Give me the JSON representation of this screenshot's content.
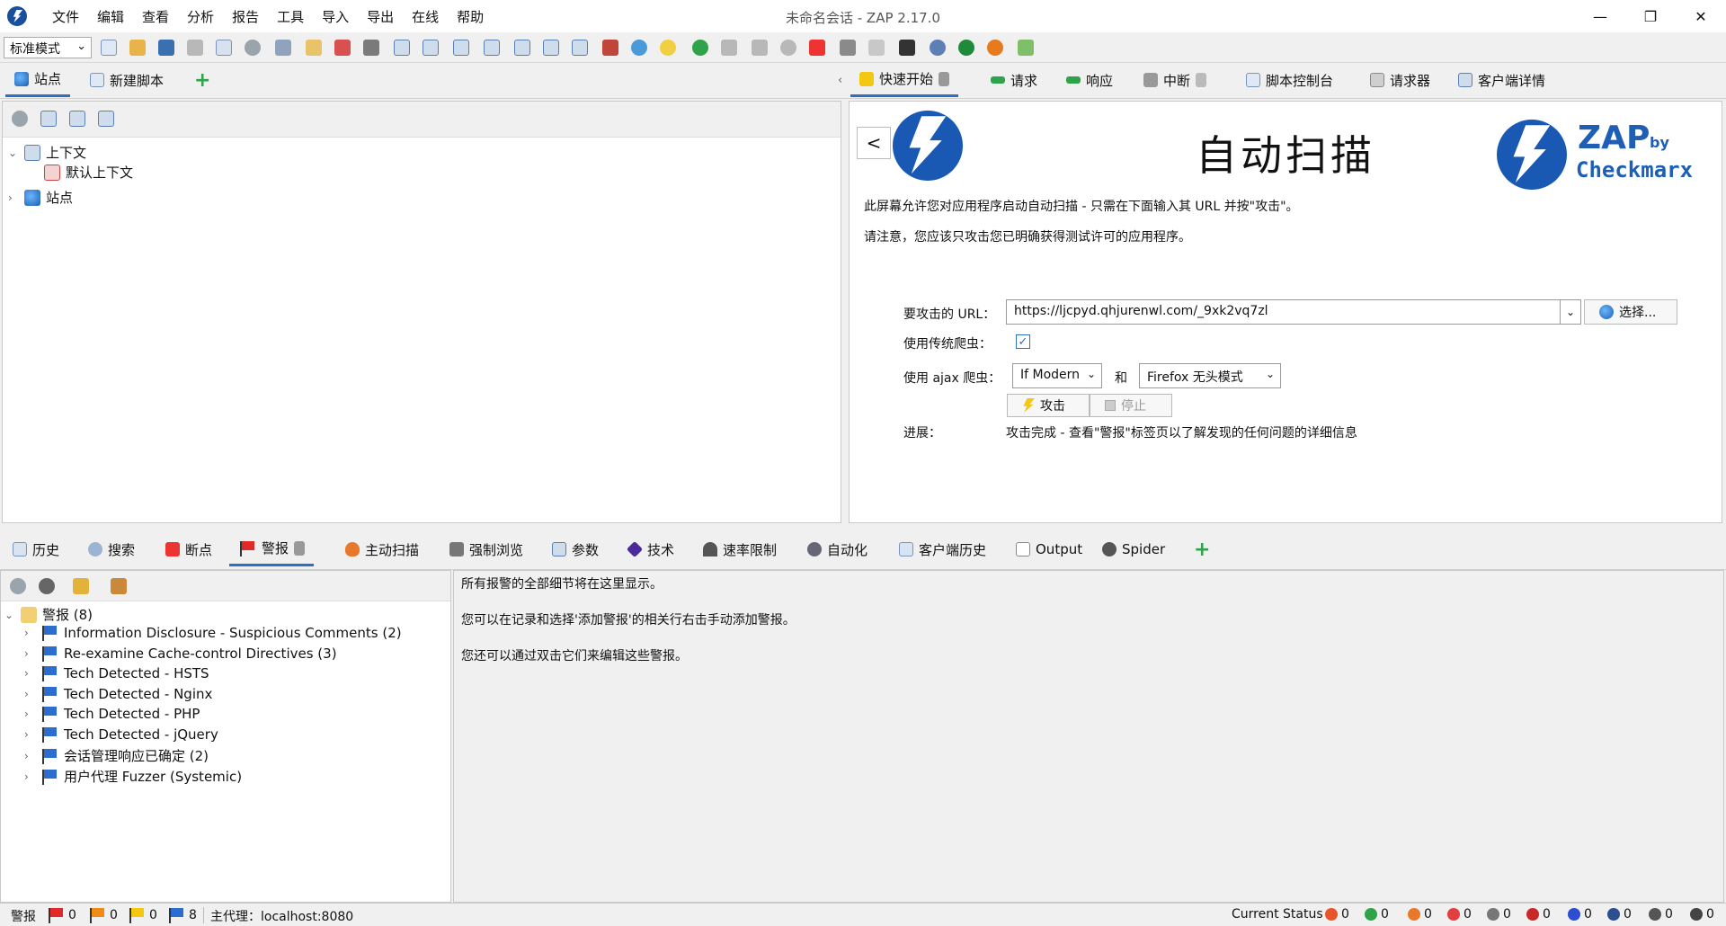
{
  "window": {
    "title": "未命名会话 - ZAP 2.17.0",
    "minimize": "—",
    "maximize": "❐",
    "close": "✕"
  },
  "menu": [
    "文件",
    "编辑",
    "查看",
    "分析",
    "报告",
    "工具",
    "导入",
    "导出",
    "在线",
    "帮助"
  ],
  "toolbar": {
    "mode": "标准模式"
  },
  "sites_tabs": {
    "sites": "站点",
    "new_script": "新建脚本",
    "add": "+"
  },
  "sites_tree": {
    "contexts": "上下文",
    "default_context": "默认上下文",
    "sites": "站点"
  },
  "right_tabs": {
    "quick_start": "快速开始",
    "request": "请求",
    "response": "响应",
    "break": "中断",
    "script_console": "脚本控制台",
    "requester": "请求器",
    "client_details": "客户端详情"
  },
  "quick_start": {
    "back": "<",
    "title": "自动扫描",
    "brand_zap": "ZAP",
    "brand_by": "by",
    "brand_checkmarx": "Checkmarx",
    "intro": "此屏幕允许您对应用程序启动自动扫描 - 只需在下面输入其 URL 并按\"攻击\"。",
    "warning": "请注意，您应该只攻击您已明确获得测试许可的应用程序。",
    "url_label": "要攻击的 URL：",
    "url_value": "https://ljcpyd.qhjurenwl.com/_9xk2vq7zl",
    "select_button": "选择...",
    "legacy_spider_label": "使用传统爬虫：",
    "legacy_spider_checked": "✓",
    "ajax_spider_label": "使用 ajax 爬虫：",
    "ajax_mode": "If Modern",
    "and_label": "和",
    "browser": "Firefox 无头模式",
    "attack_button": "攻击",
    "stop_button": "停止",
    "progress_label": "进展：",
    "progress_value": "攻击完成 - 查看\"警报\"标签页以了解发现的任何问题的详细信息"
  },
  "bottom_tabs": {
    "history": "历史",
    "search": "搜索",
    "breakpoints": "断点",
    "alerts": "警报",
    "active_scan": "主动扫描",
    "forced_browse": "强制浏览",
    "params": "参数",
    "tech": "技术",
    "rate_limit": "速率限制",
    "automation": "自动化",
    "client_history": "客户端历史",
    "output": "Output",
    "spider": "Spider",
    "add": "+"
  },
  "alerts_tree": {
    "root": "警报 (8)",
    "items": [
      "Information Disclosure - Suspicious Comments (2)",
      "Re-examine Cache-control Directives (3)",
      "Tech Detected - HSTS",
      "Tech Detected - Nginx",
      "Tech Detected - PHP",
      "Tech Detected - jQuery",
      "会话管理响应已确定 (2)",
      "用户代理 Fuzzer (Systemic)"
    ]
  },
  "alert_detail": {
    "line1": "所有报警的全部细节将在这里显示。",
    "line2": "您可以在记录和选择'添加警报'的相关行右击手动添加警报。",
    "line3": "您还可以通过双击它们来编辑这些警报。"
  },
  "statusbar": {
    "alerts_label": "警报",
    "high": "0",
    "medium": "0",
    "low": "0",
    "info": "8",
    "proxy_label": "主代理：localhost:8080",
    "current_status": "Current Status",
    "counts": [
      "0",
      "0",
      "0",
      "0",
      "0",
      "0",
      "0",
      "0",
      "0",
      "0"
    ]
  },
  "colors": {
    "accent": "#2d6fc4",
    "zap_blue": "#1959b3",
    "flag_red": "#e02a2a",
    "flag_orange": "#f08b15",
    "flag_yellow": "#f2c811",
    "flag_blue": "#2b6ed0"
  }
}
